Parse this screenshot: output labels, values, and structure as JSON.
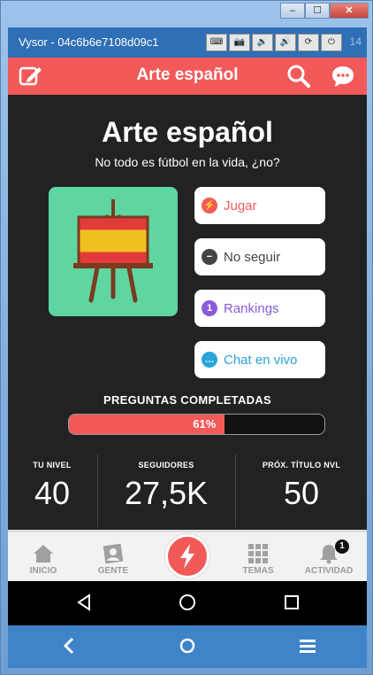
{
  "window": {
    "title": "Vysor - 04c6b6e7108d09c1",
    "minimize": "–",
    "maximize": "☐",
    "close": "✕",
    "tool_keyboard": "⌨",
    "tool_camera": "📷",
    "tool_vol_down": "🔉",
    "tool_vol_up": "🔊",
    "tool_rotate": "⟳",
    "tool_power": "⏻",
    "suffix": "14"
  },
  "appbar": {
    "title": "Arte español",
    "bg_color": "#f25a5a"
  },
  "hero": {
    "title": "Arte español",
    "subtitle": "No todo es fútbol en la vida, ¿no?"
  },
  "actions": [
    {
      "label": "Jugar",
      "icon": "bolt-icon",
      "color": "#f25a5a"
    },
    {
      "label": "No seguir",
      "icon": "minus-icon",
      "color": "#444444"
    },
    {
      "label": "Rankings",
      "icon": "medal-icon",
      "color": "#8a5bd6"
    },
    {
      "label": "Chat en vivo",
      "icon": "chat-icon",
      "color": "#2aa3d8"
    }
  ],
  "progress": {
    "label": "PREGUNTAS COMPLETADAS",
    "percent": 61,
    "percent_text": "61%"
  },
  "stats": [
    {
      "label": "TU NIVEL",
      "value": "40"
    },
    {
      "label": "SEGUIDORES",
      "value": "27,5K"
    },
    {
      "label": "PRÓX. TÍTULO NVL",
      "value": "50"
    }
  ],
  "tabs": [
    {
      "label": "INICIO"
    },
    {
      "label": "GENTE"
    },
    {
      "label": "TEMAS"
    },
    {
      "label": "ACTIVIDAD",
      "badge": "1"
    }
  ]
}
